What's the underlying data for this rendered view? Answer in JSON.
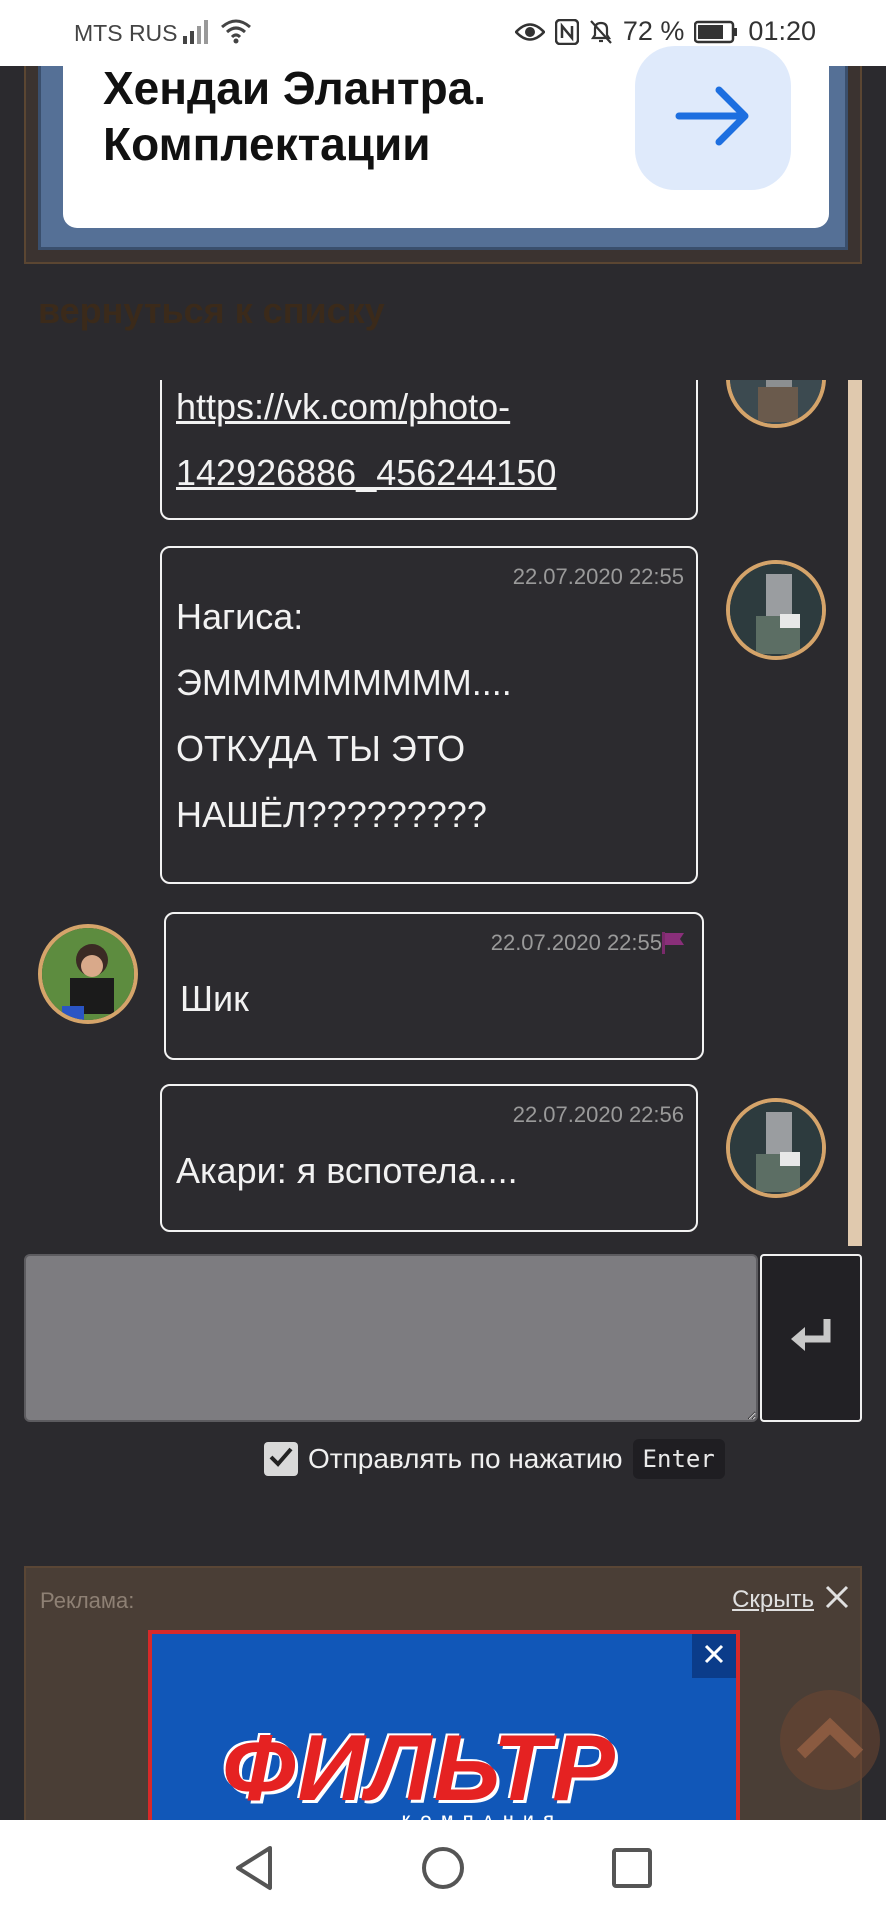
{
  "status_bar": {
    "carrier": "MTS RUS",
    "battery_percent": "72 %",
    "time": "01:20"
  },
  "ad_top": {
    "title": "Хендаи Элантра.\nКомплектации"
  },
  "back_link": "вернуться к списку",
  "messages": [
    {
      "side": "right",
      "link_line1": "https://vk.com/photo-",
      "link_line2": "142926886_456244150"
    },
    {
      "side": "right",
      "time": "22.07.2020 22:55",
      "lines": [
        "Нагиса:",
        "ЭМММММММММ....",
        "ОТКУДА ТЫ ЭТО",
        "НАШЁЛ?????????"
      ]
    },
    {
      "side": "left",
      "time": "22.07.2020 22:55",
      "text": "Шик"
    },
    {
      "side": "right",
      "time": "22.07.2020 22:56",
      "text": "Акари: я вспотела...."
    }
  ],
  "compose": {
    "placeholder": "",
    "send_on_enter_label": "Отправлять по нажатию",
    "enter_key": "Enter",
    "send_on_enter_checked": true
  },
  "ad_bottom": {
    "label": "Реклама:",
    "hide_label": "Скрыть",
    "logo_text": "ФИЛЬТР",
    "logo_sub": "КОМПАНИЯ"
  },
  "colors": {
    "page_bg": "#2b2a2e",
    "avatar_border": "#d5a46a",
    "scrollbar": "#e0c9ae",
    "ad_banner_bg": "#1157b8"
  },
  "icons": [
    "signal-icon",
    "wifi-icon",
    "eye-icon",
    "nfc-icon",
    "bell-off-icon",
    "battery-icon",
    "arrow-right-icon",
    "flag-icon",
    "enter-return-icon",
    "checkbox-icon",
    "close-icon",
    "chevron-up-icon",
    "back-triangle-icon",
    "home-circle-icon",
    "recents-square-icon"
  ]
}
